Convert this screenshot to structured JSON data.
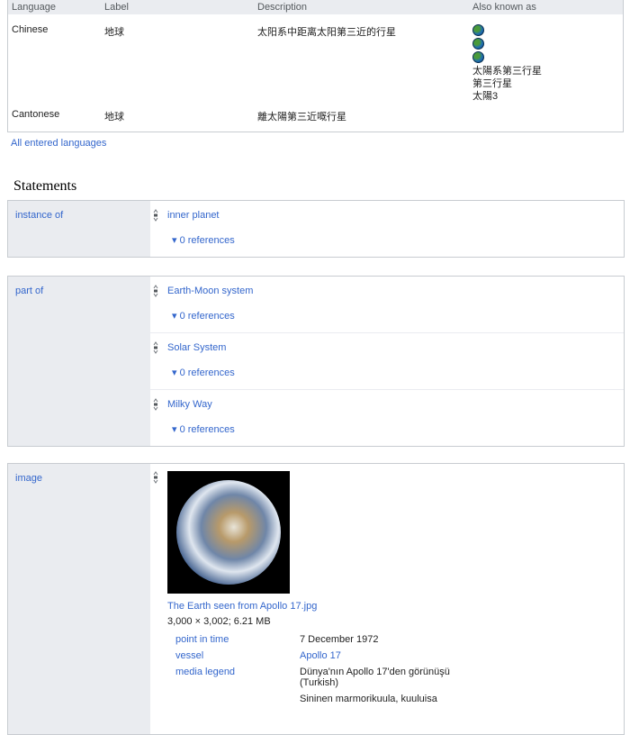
{
  "terms": {
    "headers": [
      "Language",
      "Label",
      "Description",
      "Also known as"
    ],
    "rows": [
      {
        "language": "Chinese",
        "label": "地球",
        "description": "太阳系中距离太阳第三近的行星",
        "aliases": [
          "太陽系第三行星",
          "第三行星",
          "太陽3"
        ],
        "globe_icons": 3
      },
      {
        "language": "Cantonese",
        "label": "地球",
        "description": "離太陽第三近嘅行星"
      }
    ],
    "all_languages": "All entered languages"
  },
  "statements_title": "Statements",
  "refs": "▾ 0 references",
  "groups": [
    {
      "property": "instance of",
      "values": [
        "inner planet"
      ]
    },
    {
      "property": "part of",
      "values": [
        "Earth-Moon system",
        "Solar System",
        "Milky Way"
      ]
    }
  ],
  "image": {
    "property": "image",
    "file": "The Earth seen from Apollo 17.jpg",
    "meta": "3,000 × 3,002; 6.21 MB",
    "qualifiers": [
      {
        "name": "point in time",
        "value": "7 December 1972"
      },
      {
        "name": "vessel",
        "value": "Apollo 17"
      },
      {
        "name": "media legend",
        "value": "Dünya'nın Apollo 17'den görünüşü",
        "value2": "(Turkish)",
        "value3": "Sininen marmorikuula, kuuluisa"
      }
    ]
  }
}
